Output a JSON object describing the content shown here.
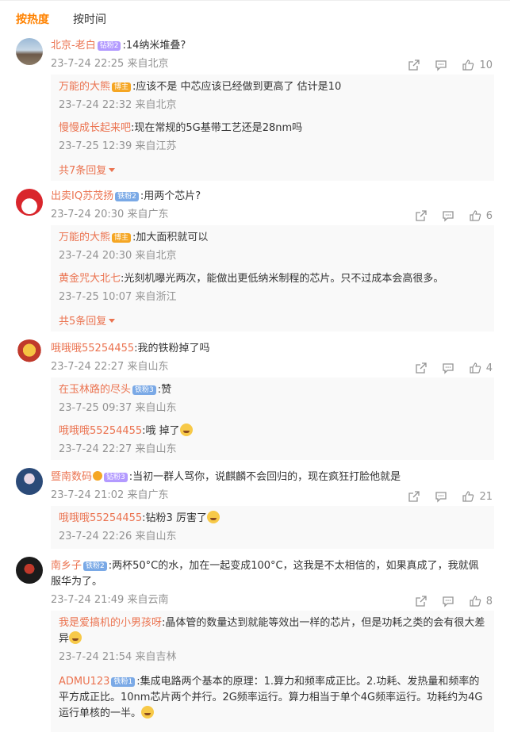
{
  "tabs": {
    "hot": "按热度",
    "time": "按时间"
  },
  "comments": [
    {
      "name": "北京-老白",
      "badge": "钻粉2",
      "text": ":14纳米堆叠?",
      "time": "23-7-24 22:25 来自北京",
      "likes": "10",
      "replies": [
        {
          "name": "万能的大熊",
          "badge": "博主",
          "text": ":应该不是 中芯应该已经做到更高了 估计是10",
          "time": "23-7-24 22:32 来自北京"
        },
        {
          "name": "慢慢成长起来吧",
          "text": ":现在常规的5G基带工艺还是28nm吗",
          "time": "23-7-25 12:39 来自江苏"
        }
      ],
      "more": "共7条回复"
    },
    {
      "name": "出卖IQ苏茂扬",
      "badge": "铁粉2",
      "text": ":用两个芯片?",
      "time": "23-7-24 20:30 来自广东",
      "likes": "6",
      "replies": [
        {
          "name": "万能的大熊",
          "badge": "博主",
          "text": ":加大面积就可以",
          "time": "23-7-24 20:30 来自北京"
        },
        {
          "name": "黄金咒大北七",
          "text": ":光刻机曝光两次，能做出更低纳米制程的芯片。只不过成本会高很多。",
          "time": "23-7-25 10:07 来自浙江"
        }
      ],
      "more": "共5条回复"
    },
    {
      "name": "哦哦哦55254455",
      "text": ":我的铁粉掉了吗",
      "time": "23-7-24 22:27 来自山东",
      "likes": "4",
      "replies": [
        {
          "name": "在玉林路的尽头",
          "badge": "铁粉3",
          "text": ":赞",
          "time": "23-7-25 09:37 来自山东"
        },
        {
          "name": "哦哦哦55254455",
          "text": ":哦 掉了",
          "time": "23-7-24 22:27 来自山东"
        }
      ]
    },
    {
      "name": "暨南数码",
      "badge": "钻粉3",
      "text": ":当初一群人骂你，说麒麟不会回归的，现在疯狂打脸他就是",
      "time": "23-7-24 21:02 来自广东",
      "likes": "21",
      "replies": [
        {
          "name": "哦哦哦55254455",
          "text": ":钻粉3 厉害了",
          "time": "23-7-24 22:26 来自山东"
        }
      ]
    },
    {
      "name": "南乡子",
      "badge": "铁粉2",
      "text": ":两杯50°C的水，加在一起变成100°C，这我是不太相信的，如果真成了，我就佩",
      "text2": "服华为了。",
      "time": "23-7-24 21:49 来自云南",
      "likes": "8",
      "replies": [
        {
          "name": "我是爱搞机的小男孩呀",
          "text": ":晶体管的数量达到就能等效出一样的芯片，但是功耗之类的会有很大差",
          "text2": "异",
          "time": "23-7-24 21:54 来自吉林"
        },
        {
          "name": "ADMU123",
          "badge": "铁粉1",
          "text": ":集成电路两个基本的原理：1.算力和频率成正比。2.功耗、发热量和频率的",
          "text2": "平方成正比。10nm芯片两个并行。2G频率运行。算力相当于单个4G频率运行。功耗约为4G",
          "text3": "运行单核的一半。"
        }
      ]
    }
  ]
}
